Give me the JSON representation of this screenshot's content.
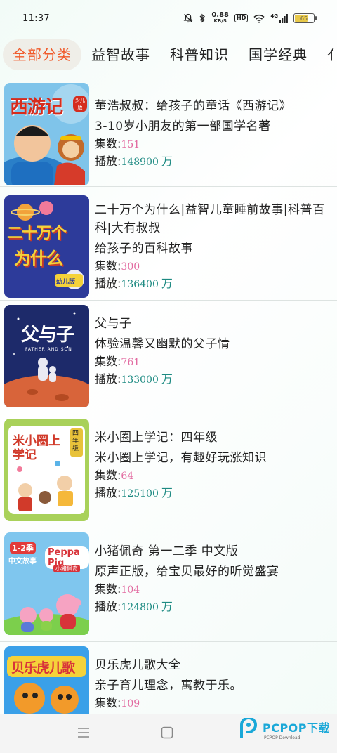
{
  "status_bar": {
    "time": "11:37",
    "net_speed_value": "0.88",
    "net_speed_unit": "KB/S",
    "hd_label": "HD",
    "signal_label": "4G",
    "battery_level": "65",
    "battery_fraction": 0.65
  },
  "tabs": [
    {
      "label": "全部分类",
      "active": true
    },
    {
      "label": "益智故事",
      "active": false
    },
    {
      "label": "科普知识",
      "active": false
    },
    {
      "label": "国学经典",
      "active": false
    },
    {
      "label": "亻",
      "active": false
    }
  ],
  "labels": {
    "episodes": "集数:",
    "plays": "播放:",
    "unit": "万"
  },
  "items": [
    {
      "title": "董浩叔叔：给孩子的童话《西游记》",
      "subtitle": "3-10岁小朋友的第一部国学名著",
      "episodes": "151",
      "plays": "148900",
      "cover_text": "西游记",
      "cover_badge": "少儿版"
    },
    {
      "title": "二十万个为什么|益智儿童睡前故事|科普百科|大有叔叔",
      "subtitle": "给孩子的百科故事",
      "episodes": "300",
      "plays": "136400",
      "cover_text_line1": "二十万个",
      "cover_text_line2": "为什么",
      "cover_badge": "幼儿版"
    },
    {
      "title": "父与子",
      "subtitle": "体验温馨又幽默的父子情",
      "episodes": "761",
      "plays": "133000",
      "cover_text": "父与子",
      "cover_sub": "FATHER AND SON"
    },
    {
      "title": "米小圈上学记：四年级",
      "subtitle": "米小圈上学记，有趣好玩涨知识",
      "episodes": "64",
      "plays": "125100",
      "cover_text": "米小圈上学记",
      "cover_badge": "四年级"
    },
    {
      "title": "小猪佩奇 第一二季 中文版",
      "subtitle": "原声正版，给宝贝最好的听觉盛宴",
      "episodes": "104",
      "plays": "124800",
      "cover_text_line1": "1-2季",
      "cover_text_line2": "中文故事",
      "cover_brand": "Peppa Pig",
      "cover_sub": "小猪佩奇"
    },
    {
      "title": "贝乐虎儿歌大全",
      "subtitle": "亲子育儿理念，寓教于乐。",
      "episodes": "109",
      "cover_text": "贝乐虎儿歌"
    }
  ],
  "watermark": {
    "text": "PCPOP下载",
    "sub": "PCPOP Download"
  },
  "colors": {
    "active_tab": "#f05a2a",
    "episodes_number": "#e26aa0",
    "plays_number": "#1d8a82"
  }
}
